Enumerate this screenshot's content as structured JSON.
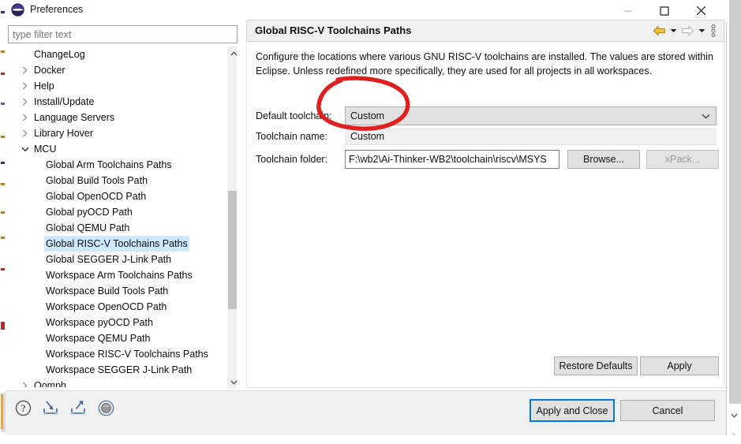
{
  "window": {
    "title": "Preferences",
    "icon": "eclipse-globe-icon",
    "minimize_label": "–",
    "maximize_label": "□",
    "close_label": "✕"
  },
  "sidebar": {
    "filter": {
      "value": "",
      "placeholder": "type filter text"
    },
    "items": [
      {
        "label": "ChangeLog",
        "level": 1,
        "twisty": "none",
        "selected": false
      },
      {
        "label": "Docker",
        "level": 1,
        "twisty": "collapsed",
        "selected": false
      },
      {
        "label": "Help",
        "level": 1,
        "twisty": "collapsed",
        "selected": false
      },
      {
        "label": "Install/Update",
        "level": 1,
        "twisty": "collapsed",
        "selected": false
      },
      {
        "label": "Language Servers",
        "level": 1,
        "twisty": "collapsed",
        "selected": false
      },
      {
        "label": "Library Hover",
        "level": 1,
        "twisty": "collapsed",
        "selected": false
      },
      {
        "label": "MCU",
        "level": 1,
        "twisty": "expanded",
        "selected": false
      },
      {
        "label": "Global Arm Toolchains Paths",
        "level": 2,
        "twisty": "none",
        "selected": false
      },
      {
        "label": "Global Build Tools Path",
        "level": 2,
        "twisty": "none",
        "selected": false
      },
      {
        "label": "Global OpenOCD Path",
        "level": 2,
        "twisty": "none",
        "selected": false
      },
      {
        "label": "Global pyOCD Path",
        "level": 2,
        "twisty": "none",
        "selected": false
      },
      {
        "label": "Global QEMU Path",
        "level": 2,
        "twisty": "none",
        "selected": false
      },
      {
        "label": "Global RISC-V Toolchains Paths",
        "level": 2,
        "twisty": "none",
        "selected": true
      },
      {
        "label": "Global SEGGER J-Link Path",
        "level": 2,
        "twisty": "none",
        "selected": false
      },
      {
        "label": "Workspace Arm Toolchains Paths",
        "level": 2,
        "twisty": "none",
        "selected": false
      },
      {
        "label": "Workspace Build Tools Path",
        "level": 2,
        "twisty": "none",
        "selected": false
      },
      {
        "label": "Workspace OpenOCD Path",
        "level": 2,
        "twisty": "none",
        "selected": false
      },
      {
        "label": "Workspace pyOCD Path",
        "level": 2,
        "twisty": "none",
        "selected": false
      },
      {
        "label": "Workspace QEMU Path",
        "level": 2,
        "twisty": "none",
        "selected": false
      },
      {
        "label": "Workspace RISC-V Toolchains Paths",
        "level": 2,
        "twisty": "none",
        "selected": false
      },
      {
        "label": "Workspace SEGGER J-Link Path",
        "level": 2,
        "twisty": "none",
        "selected": false
      },
      {
        "label": "Oomph",
        "level": 1,
        "twisty": "collapsed",
        "selected": false
      }
    ]
  },
  "page": {
    "title": "Global RISC-V Toolchains Paths",
    "description": "Configure the locations where various GNU RISC-V toolchains are installed. The values are stored within Eclipse. Unless redefined more specifically, they are used for all projects in all workspaces.",
    "nav": {
      "back_icon": "back-arrow-icon",
      "back_menu_icon": "chevron-down-icon",
      "forward_icon": "forward-arrow-icon",
      "forward_menu_icon": "chevron-down-icon",
      "overflow_icon": "vertical-ellipsis-icon"
    },
    "fields": {
      "default_toolchain": {
        "label": "Default toolchain:",
        "value": "Custom",
        "options": [
          "Custom"
        ]
      },
      "toolchain_name": {
        "label": "Toolchain name:",
        "value": "Custom"
      },
      "toolchain_folder": {
        "label": "Toolchain folder:",
        "value": "F:\\wb2\\Ai-Thinker-WB2\\toolchain\\riscv\\MSYS",
        "browse_label": "Browse...",
        "xpack_label": "xPack...",
        "xpack_disabled": true
      }
    },
    "buttons": {
      "restore_defaults": "Restore Defaults",
      "apply": "Apply"
    }
  },
  "footer": {
    "icons": [
      {
        "name": "help-icon",
        "title": "?"
      },
      {
        "name": "import-icon",
        "title": "Import"
      },
      {
        "name": "export-icon",
        "title": "Export"
      },
      {
        "name": "oomph-recorder-icon",
        "title": "Record"
      }
    ],
    "apply_and_close": "Apply and Close",
    "cancel": "Cancel"
  },
  "annotation": {
    "shape": "ellipse",
    "color": "#e02020",
    "target": "Default toolchain / Toolchain name fields"
  },
  "colors": {
    "selection_blue": "#cde8ff",
    "focus_blue": "#0078d7",
    "annotation_red": "#e02020",
    "panel_grey": "#f0f0f0",
    "button_grey": "#e1e1e1"
  }
}
